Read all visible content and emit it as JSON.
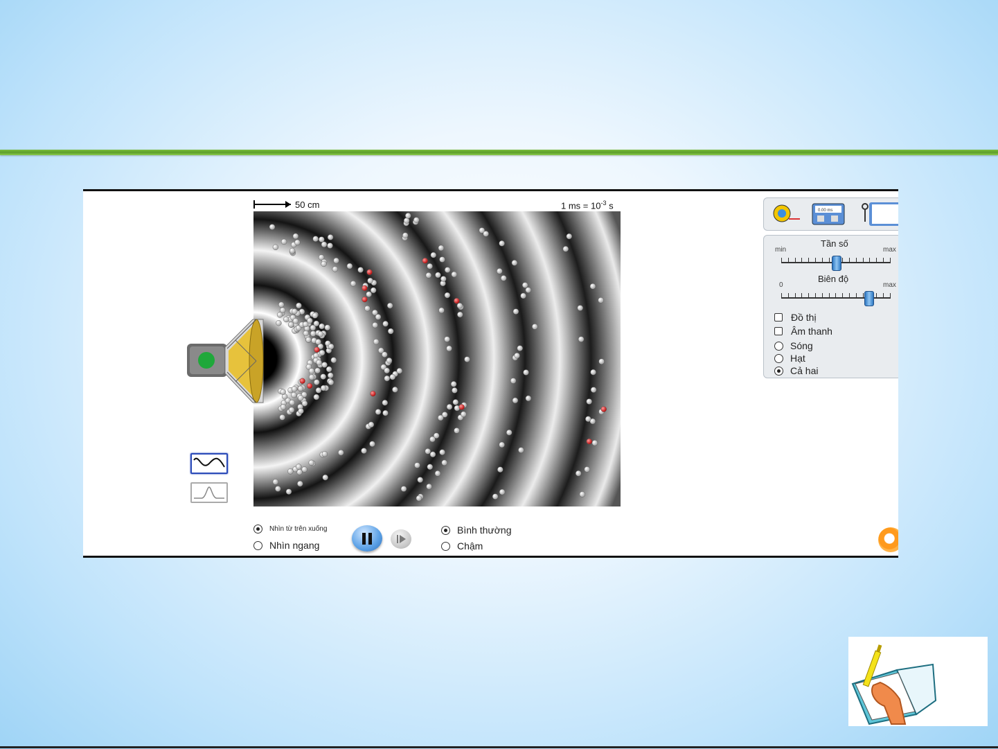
{
  "simulation": {
    "scale_label": "50 cm",
    "time_label_prefix": "1 ms = 10",
    "time_label_exp": "-3",
    "time_label_suffix": " s",
    "view_options": [
      {
        "label": "Nhìn từ trên xuống",
        "selected": true
      },
      {
        "label": "Nhìn ngang",
        "selected": false
      }
    ],
    "speed_options": [
      {
        "label": "Bình thường",
        "selected": true
      },
      {
        "label": "Chậm",
        "selected": false
      }
    ],
    "playback": {
      "paused": false
    },
    "waveform_options": [
      {
        "name": "continuous-sine",
        "active": true
      },
      {
        "name": "single-pulse",
        "active": false
      }
    ]
  },
  "controls": {
    "frequency": {
      "title": "Tần số",
      "min_label": "min",
      "max_label": "max",
      "value": 0.5
    },
    "amplitude": {
      "title": "Biên độ",
      "min_label": "0",
      "max_label": "max",
      "value": 0.8
    },
    "checkboxes": [
      {
        "label": "Đồ thị",
        "checked": false
      },
      {
        "label": "Âm thanh",
        "checked": false
      }
    ],
    "display_options": [
      {
        "label": "Sóng",
        "selected": false
      },
      {
        "label": "Hạt",
        "selected": false
      },
      {
        "label": "Cả hai",
        "selected": true
      }
    ]
  },
  "tools": {
    "stopwatch_readout": "0.00 ms"
  },
  "colors": {
    "accent_green": "#6cb133",
    "particle_white": "#f5f5f5",
    "particle_red": "#e02020"
  }
}
